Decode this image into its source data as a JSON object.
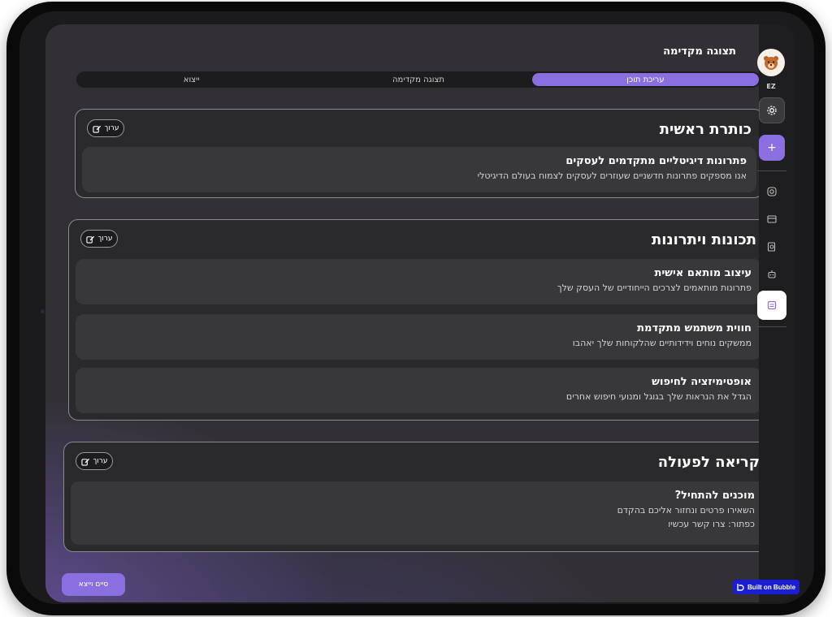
{
  "header": {
    "title": "תצוגה מקדימה"
  },
  "tabs": [
    {
      "label": "עריכת תוכן",
      "active": true
    },
    {
      "label": "תצוגה מקדימה",
      "active": false
    },
    {
      "label": "ייצוא",
      "active": false
    }
  ],
  "edit_label": "ערוך",
  "sections": [
    {
      "title": "כותרת ראשית",
      "cards": [
        {
          "title": "פתרונות דיגיטליים מתקדמים לעסקים",
          "lines": [
            "אנו מספקים פתרונות חדשניים שעוזרים לעסקים לצמוח בעולם הדיגיטלי"
          ]
        }
      ]
    },
    {
      "title": "תכונות ויתרונות",
      "cards": [
        {
          "title": "עיצוב מותאם אישית",
          "lines": [
            "פתרונות מותאמים לצרכים הייחודיים של העסק שלך"
          ]
        },
        {
          "title": "חווית משתמש מתקדמת",
          "lines": [
            "ממשקים נוחים וידידותיים שהלקוחות שלך יאהבו"
          ]
        },
        {
          "title": "אופטימיזציה לחיפוש",
          "lines": [
            "הגדל את הנראות שלך בגוגל ומנועי חיפוש אחרים"
          ]
        }
      ]
    },
    {
      "title": "קריאה לפעולה",
      "cards": [
        {
          "title": "מוכנים להתחיל?",
          "lines": [
            "השאירו פרטים ונחזור אליכם בהקדם",
            "כפתור: צרו קשר עכשיו"
          ]
        }
      ]
    }
  ],
  "footer": {
    "finish_label": "סיים וייצא"
  },
  "sidebar": {
    "initials": "EZ",
    "add_label": "+",
    "icons": [
      "settings-icon",
      "add-icon",
      "instagram-icon",
      "layout-icon",
      "search-doc-icon",
      "robot-icon",
      "page-icon"
    ]
  },
  "badge": {
    "label": "Built on Bubble"
  },
  "colors": {
    "accent": "#8b6fe0",
    "panel": "#2a2a2c",
    "card": "#38383b",
    "badge": "#1a1fd6"
  }
}
